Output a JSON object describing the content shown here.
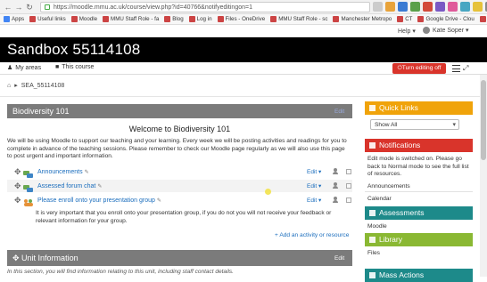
{
  "browser": {
    "url": "https://moodle.mmu.ac.uk/course/view.php?id=40766&notifyeditingon=1",
    "bookmarks": [
      "Apps",
      "Useful links",
      "Moodle",
      "MMU Staff Role - fa",
      "Blog",
      "Log in",
      "Files - OneDrive",
      "MMU Staff Role - sc",
      "Manchester Metropo",
      "CT",
      "Google Drive - Clou",
      "RAP"
    ]
  },
  "header": {
    "help": "Help ▾",
    "user": "Kate Soper ▾",
    "course_title": "Sandbox 55114108",
    "my_areas": "My areas",
    "this_course": "This course",
    "editing_button": "Turn editing off"
  },
  "breadcrumb": {
    "course": "SEA_55114108"
  },
  "sections": [
    {
      "title": "Biodiversity 101",
      "edit": "Edit"
    },
    {
      "title": "Unit Information",
      "edit": "Edit"
    }
  ],
  "welcome": {
    "heading": "Welcome to Biodiversity 101",
    "intro": "We will be using Moodle to support our teaching and your learning. Every week we will be  posting activities and readings for you to complete in advance of the teaching sessions. Please remember to check our Moodle page regularly as we will also use this page to post urgent and important information."
  },
  "activities": [
    {
      "name": "Announcements",
      "edit": "Edit ▾",
      "icon": "forum-icon"
    },
    {
      "name": "Assessed forum chat",
      "edit": "Edit ▾",
      "icon": "forum-icon"
    },
    {
      "name": "Please enroll onto your presentation group",
      "edit": "Edit ▾",
      "icon": "group-choice-icon"
    }
  ],
  "note": "It is very important that you enroll onto your presentation group, if you do not you will not receive your feedback or relevant information for your group.",
  "add_activity": "+ Add an activity or resource",
  "unit_info_desc": "In this section, you will find information relating to this unit, including staff contact details.",
  "blocks": {
    "quick_links": {
      "title": "Quick Links",
      "select": "Show All",
      "color": "#f0a30a"
    },
    "notifications": {
      "title": "Notifications",
      "text": "Edit mode is switched on. Please go back to Normal mode to see the full list of resources.",
      "color": "#d9342b"
    },
    "links": [
      "Announcements",
      "Calendar"
    ],
    "assessments": {
      "title": "Assessments",
      "item": "Moodle",
      "color": "#1d8a8a"
    },
    "library": {
      "title": "Library",
      "item": "Files",
      "color": "#8ab833"
    },
    "mass_actions": {
      "title": "Mass Actions",
      "color": "#1d8a8a"
    }
  }
}
